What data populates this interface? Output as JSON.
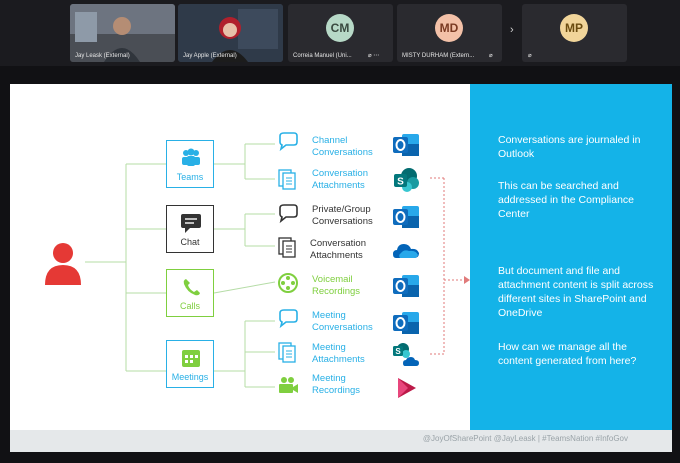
{
  "participants": [
    {
      "name": "Jay Leask (External)",
      "type": "video"
    },
    {
      "name": "Jay Apple (External)",
      "type": "video"
    },
    {
      "name": "Correia Manuel (Uni...",
      "type": "avatar",
      "initials": "CM",
      "color": "#b7d9c7"
    },
    {
      "name": "MISTY DURHAM (Extern...",
      "type": "avatar",
      "initials": "MD",
      "color": "#f3c1a8"
    },
    {
      "name": "",
      "type": "avatar",
      "initials": "MP",
      "color": "#f1d59a"
    }
  ],
  "slide": {
    "person_icon": "person-icon",
    "categories": [
      {
        "label": "Teams",
        "icon": "teams-icon",
        "color": "#29b0e6"
      },
      {
        "label": "Chat",
        "icon": "chat-icon",
        "color": "#333333"
      },
      {
        "label": "Calls",
        "icon": "phone-icon",
        "color": "#7fcf3f"
      },
      {
        "label": "Meetings",
        "icon": "calendar-icon",
        "color": "#29b0e6"
      }
    ],
    "rows": [
      {
        "line1": "Channel",
        "line2": "Conversations",
        "icon": "chat-bubbles-icon",
        "app": "outlook-icon"
      },
      {
        "line1": "Conversation",
        "line2": "Attachments",
        "icon": "documents-icon",
        "app": "sharepoint-icon"
      },
      {
        "line1": "Private/Group",
        "line2": "Conversations",
        "icon": "chat-bubbles-icon",
        "app": "outlook-icon"
      },
      {
        "line1": "Conversation",
        "line2": "Attachments",
        "icon": "documents-icon",
        "app": "onedrive-icon"
      },
      {
        "line1": "Voicemail",
        "line2": "Recordings",
        "icon": "film-reel-icon",
        "app": "outlook-icon"
      },
      {
        "line1": "Meeting",
        "line2": "Conversations",
        "icon": "chat-bubbles-icon",
        "app": "outlook-icon"
      },
      {
        "line1": "Meeting",
        "line2": "Attachments",
        "icon": "documents-icon",
        "app": "sharepoint-onedrive-icon"
      },
      {
        "line1": "Meeting",
        "line2": "Recordings",
        "icon": "video-camera-icon",
        "app": "stream-icon"
      }
    ],
    "panel": {
      "p1": "Conversations are journaled in Outlook",
      "p2": "This can be searched and addressed in the Compliance Center",
      "p3": "But document and file and attachment content is split across different sites in SharePoint and OneDrive",
      "p4": "How can we manage all the content generated from here?"
    },
    "footer": "@JoyOfSharePoint @JayLeask | #TeamsNation #InfoGov"
  }
}
